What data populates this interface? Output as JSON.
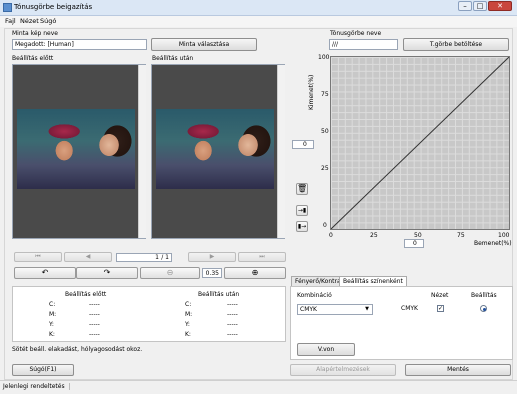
{
  "window": {
    "title": "Tónusgörbe beigazítás",
    "controls": {
      "minimize": "–",
      "maximize": "□",
      "close": "✕"
    }
  },
  "menu": [
    "Fajl",
    "Nézet",
    "Súgó"
  ],
  "sample": {
    "label": "Minta kép neve",
    "value": "Megadott: [Human]",
    "button": "Minta választása"
  },
  "preview": {
    "before_label": "Beállítás előtt",
    "after_label": "Beállítás után",
    "page_current": "1",
    "page_total": "/ 1",
    "zoom": "0.35"
  },
  "curve": {
    "label": "Tónusgörbe neve",
    "value": "///",
    "button": "T.görbe betöltése",
    "output_axis": "Kimenet(%)",
    "input_axis": "Bemenet(%)",
    "y_ticks": [
      "100",
      "75",
      "50",
      "25",
      "0"
    ],
    "x_ticks": [
      "0",
      "25",
      "50",
      "75",
      "100"
    ],
    "left_spin": "0",
    "bottom_spin": "0"
  },
  "values_table": {
    "before": "Beállítás előtt",
    "after": "Beállítás után",
    "rows": [
      {
        "k": "C:",
        "b": "-----",
        "a": "-----"
      },
      {
        "k": "M:",
        "b": "-----",
        "a": "-----"
      },
      {
        "k": "Y:",
        "b": "-----",
        "a": "-----"
      },
      {
        "k": "K:",
        "b": "-----",
        "a": "-----"
      }
    ]
  },
  "note": "Sötét beáll. elakadást, hólyagosodást okoz.",
  "tabs": [
    "Fényerő/Kontraszt",
    "Beállítás színenként"
  ],
  "color_tab": {
    "combination_label": "Kombináció",
    "combination_value": "CMYK",
    "view_label": "Nézet",
    "adjust_label": "Beállítás",
    "row_label": "CMYK",
    "reset_button": "V.von"
  },
  "footer": {
    "help_button": "Súgó(F1)",
    "restore_button": "Alapértelmezések",
    "save_button": "Mentés",
    "status": "Jelenlegi rendeltetés"
  }
}
